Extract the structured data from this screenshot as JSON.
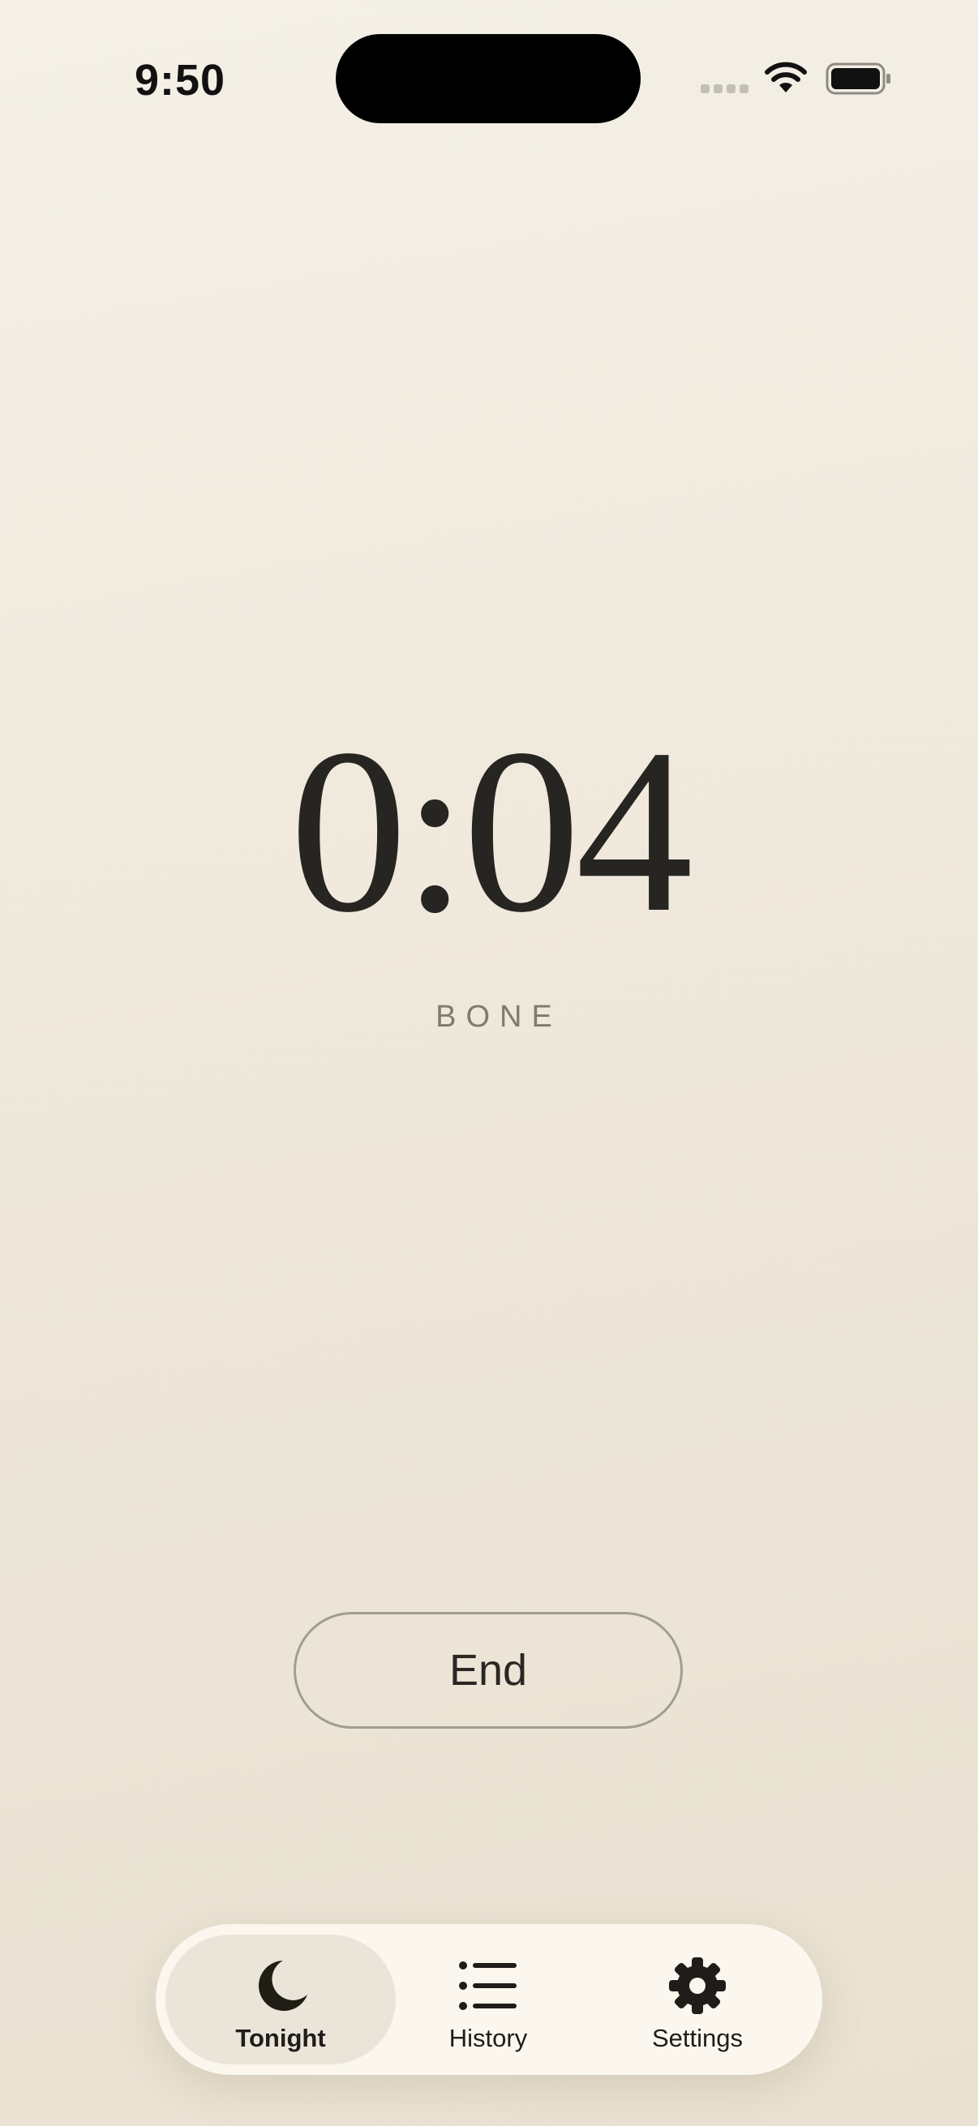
{
  "status_bar": {
    "time": "9:50",
    "icons": [
      "cellular-signal-icon",
      "wifi-icon",
      "battery-icon"
    ]
  },
  "timer": {
    "elapsed": "0:04",
    "sound_name": "BONE"
  },
  "actions": {
    "end_label": "End"
  },
  "tab_bar": {
    "items": [
      {
        "label": "Tonight",
        "icon": "moon-icon",
        "active": true
      },
      {
        "label": "History",
        "icon": "list-icon",
        "active": false
      },
      {
        "label": "Settings",
        "icon": "gear-icon",
        "active": false
      }
    ]
  },
  "colors": {
    "background": "#f1ebdf",
    "text": "#272522",
    "muted_text": "#7f7a71",
    "tab_bar": "#fbf7ee",
    "active_tab": "#ebe5d9"
  }
}
